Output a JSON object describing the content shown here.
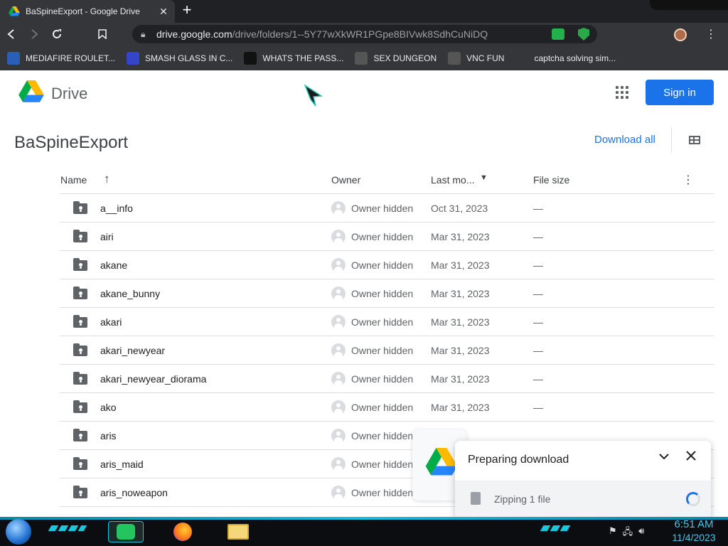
{
  "browser": {
    "tab_title": "BaSpineExport - Google Drive",
    "tab_close": "✕",
    "new_tab": "+",
    "url_host": "drive.google.com",
    "url_path": "/drive/folders/1--5Y77wXkWR1PGpe8BIVwk8SdhCuNiDQ",
    "bookmarks": [
      {
        "label": "MEDIAFIRE ROULET...",
        "icon": "mediafire-icon",
        "color": "#2a5fb8"
      },
      {
        "label": "SMASH GLASS IN C...",
        "icon": "smash-glass-icon",
        "color": "#3545c8"
      },
      {
        "label": "WHATS THE PASS...",
        "icon": "dark-square-icon",
        "color": "#111111"
      },
      {
        "label": "SEX DUNGEON",
        "icon": "gear-icon",
        "color": "#555555"
      },
      {
        "label": "VNC FUN",
        "icon": "gear-icon",
        "color": "#555555"
      },
      {
        "label": "captcha solving sim...",
        "icon": "a-logo-icon",
        "color": "#35363a"
      }
    ]
  },
  "drive": {
    "app_name": "Drive",
    "signin_label": "Sign in",
    "folder_name": "BaSpineExport",
    "download_all_label": "Download all",
    "columns": {
      "name": "Name",
      "sort_arrow": "↑",
      "owner": "Owner",
      "last_modified": "Last mo...",
      "file_size": "File size",
      "more": "⋮"
    },
    "rows": [
      {
        "name": "a__info",
        "owner": "Owner hidden",
        "modified": "Oct 31, 2023",
        "size": "—"
      },
      {
        "name": "airi",
        "owner": "Owner hidden",
        "modified": "Mar 31, 2023",
        "size": "—"
      },
      {
        "name": "akane",
        "owner": "Owner hidden",
        "modified": "Mar 31, 2023",
        "size": "—"
      },
      {
        "name": "akane_bunny",
        "owner": "Owner hidden",
        "modified": "Mar 31, 2023",
        "size": "—"
      },
      {
        "name": "akari",
        "owner": "Owner hidden",
        "modified": "Mar 31, 2023",
        "size": "—"
      },
      {
        "name": "akari_newyear",
        "owner": "Owner hidden",
        "modified": "Mar 31, 2023",
        "size": "—"
      },
      {
        "name": "akari_newyear_diorama",
        "owner": "Owner hidden",
        "modified": "Mar 31, 2023",
        "size": "—"
      },
      {
        "name": "ako",
        "owner": "Owner hidden",
        "modified": "Mar 31, 2023",
        "size": "—"
      },
      {
        "name": "aris",
        "owner": "Owner hidden",
        "modified": "",
        "size": ""
      },
      {
        "name": "aris_maid",
        "owner": "Owner hidden",
        "modified": "",
        "size": ""
      },
      {
        "name": "aris_noweapon",
        "owner": "Owner hidden",
        "modified": "",
        "size": ""
      }
    ],
    "download_panel": {
      "title": "Preparing download",
      "item": "Zipping 1 file"
    }
  },
  "taskbar": {
    "time": "6:51 AM",
    "date": "11/4/2023"
  },
  "colors": {
    "accent": "#1a73e8",
    "chrome_dark": "#35363a",
    "taskbar_glow": "#16c0d8"
  }
}
